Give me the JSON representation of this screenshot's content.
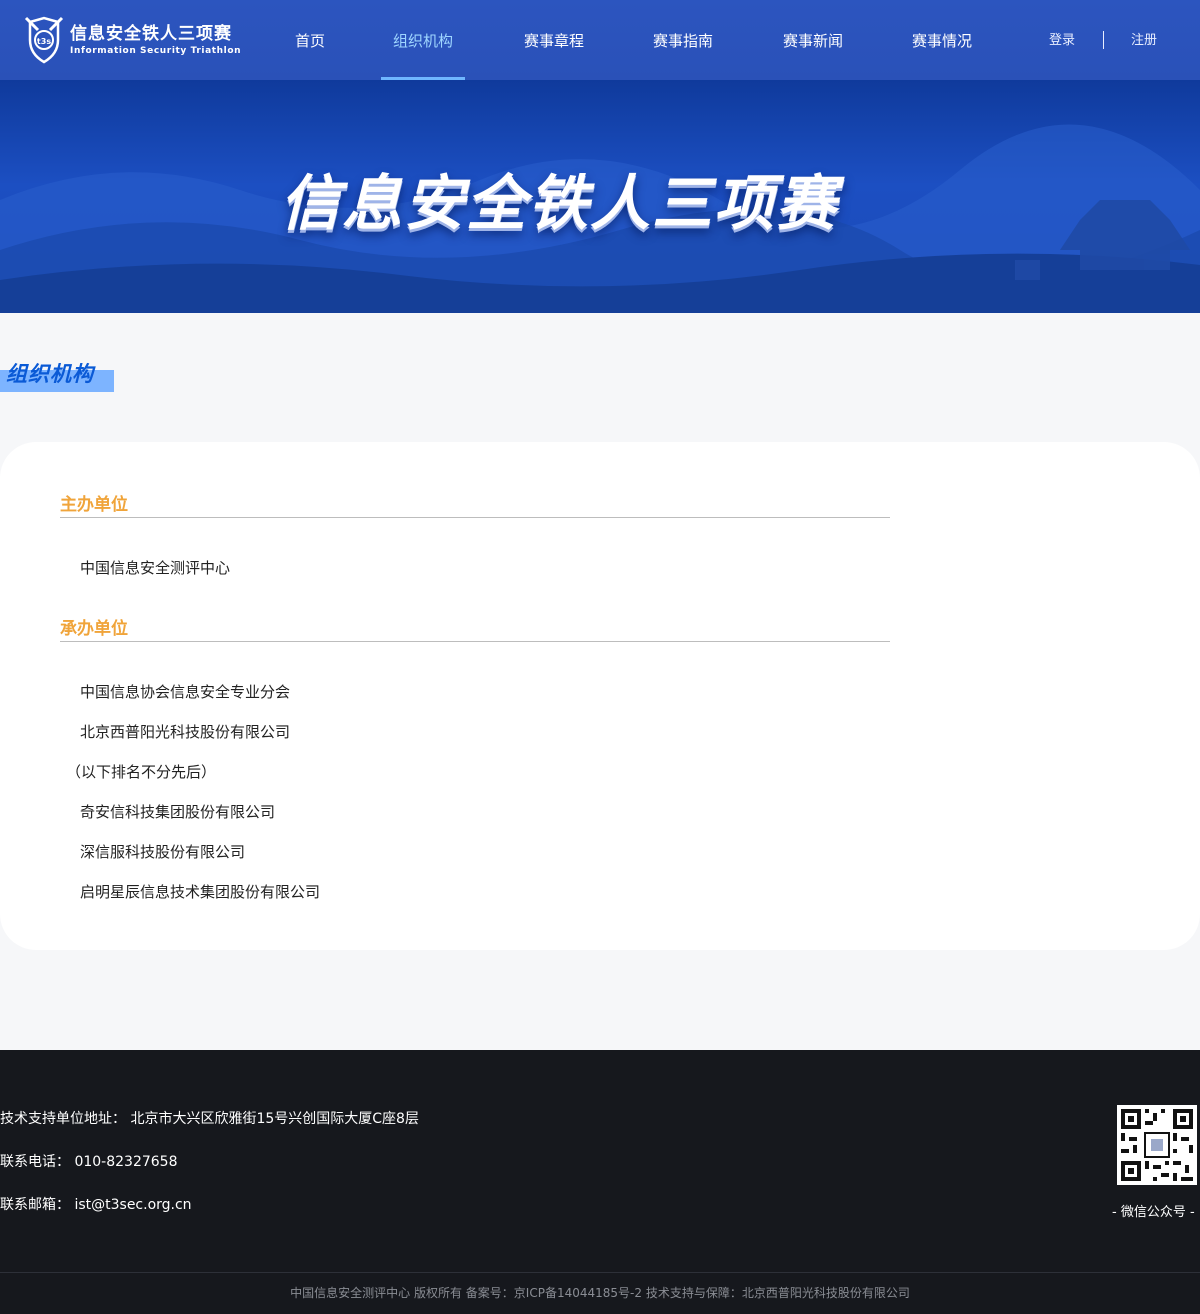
{
  "header": {
    "logo_title": "信息安全铁人三项赛",
    "logo_subtitle": "Information Security Triathlon",
    "nav": [
      {
        "label": "首页",
        "active": false
      },
      {
        "label": "组织机构",
        "active": true
      },
      {
        "label": "赛事章程",
        "active": false
      },
      {
        "label": "赛事指南",
        "active": false
      },
      {
        "label": "赛事新闻",
        "active": false
      },
      {
        "label": "赛事情况",
        "active": false
      }
    ],
    "login_label": "登录",
    "register_label": "注册",
    "colors": {
      "bar": "#2a51b8",
      "active": "#9fd6ff"
    }
  },
  "banner": {
    "title": "信息安全铁人三项赛"
  },
  "section": {
    "title": "组织机构"
  },
  "card": {
    "groups": [
      {
        "title": "主办单位",
        "entries": [
          "中国信息安全测评中心"
        ]
      },
      {
        "title": "承办单位",
        "entries": [
          "中国信息协会信息安全专业分会",
          "北京西普阳光科技股份有限公司",
          "（以下排名不分先后）",
          "奇安信科技集团股份有限公司",
          "深信服科技股份有限公司",
          "启明星辰信息技术集团股份有限公司"
        ]
      }
    ],
    "accent_color": "#f0a43a"
  },
  "footer": {
    "address": "技术支持单位地址： 北京市大兴区欣雅街15号兴创国际大厦C座8层",
    "phone": "联系电话： 010-82327658",
    "email": "联系邮箱： ist@t3sec.org.cn",
    "qr_label": "- 微信公众号 -",
    "qr_icon": "qr-code-icon",
    "copyright": "中国信息安全测评中心 版权所有 备案号：京ICP备14044185号-2 技术支持与保障：北京西普阳光科技股份有限公司"
  }
}
